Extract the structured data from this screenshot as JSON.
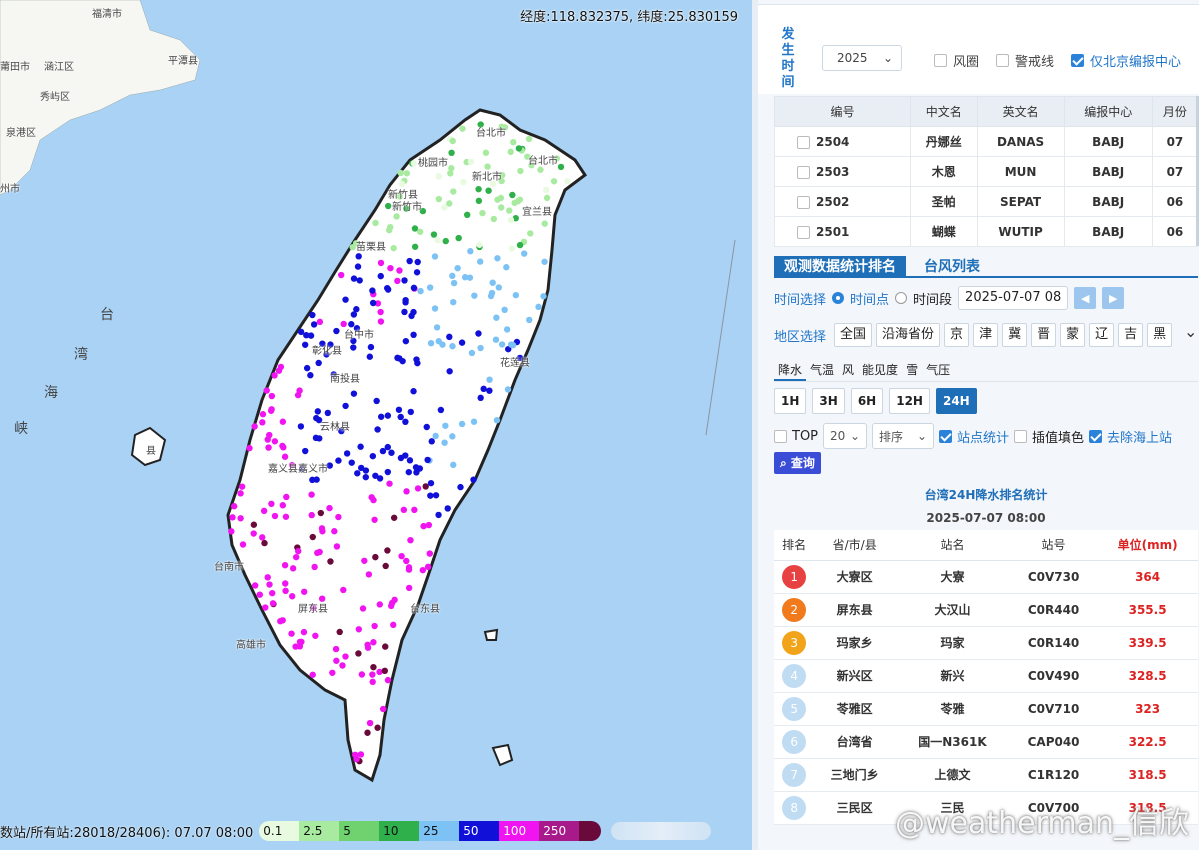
{
  "map": {
    "coord": "经度:118.832375, 纬度:25.830159",
    "labels": [
      "福清市",
      "平潭县",
      "莆田市",
      "涵江区",
      "秀屿区",
      "泉港区",
      "州市",
      "台北市",
      "桃园市",
      "新北市",
      "台北市",
      "新竹县",
      "新竹市",
      "宜兰县",
      "苗栗县",
      "台中市",
      "彰化县",
      "南投县",
      "花莲县",
      "云林县",
      "嘉义县",
      "嘉义市",
      "台南市",
      "屏东县",
      "台东县",
      "高雄市",
      "县"
    ],
    "strait": [
      "台",
      "湾",
      "海",
      "峡"
    ],
    "legend_title": "数站/所有站:28018/28406): 07.07 08:00",
    "legend": [
      {
        "label": "0.1",
        "color": "#e8fae0"
      },
      {
        "label": "2.5",
        "color": "#a8eba0"
      },
      {
        "label": "5",
        "color": "#6fd26f"
      },
      {
        "label": "10",
        "color": "#2fb04a"
      },
      {
        "label": "25",
        "color": "#7cc2f4"
      },
      {
        "label": "50",
        "color": "#1010d8"
      },
      {
        "label": "100",
        "color": "#f014f0"
      },
      {
        "label": "250",
        "color": "#a81a8c"
      },
      {
        "label": "",
        "color": "#6a0a3a"
      }
    ]
  },
  "panel": {
    "header": {
      "faction": "发生时间",
      "year": "2025",
      "opt1": "风圈",
      "opt2": "警戒线",
      "opt3": "仅北京编报中心"
    },
    "typhoon_table": {
      "headers": [
        "编号",
        "中文名",
        "英文名",
        "编报中心",
        "月份"
      ],
      "rows": [
        [
          "2504",
          "丹娜丝",
          "DANAS",
          "BABJ",
          "07"
        ],
        [
          "2503",
          "木恩",
          "MUN",
          "BABJ",
          "07"
        ],
        [
          "2502",
          "圣帕",
          "SEPAT",
          "BABJ",
          "06"
        ],
        [
          "2501",
          "蝴蝶",
          "WUTIP",
          "BABJ",
          "06"
        ]
      ]
    },
    "tabs": {
      "active": "观测数据统计排名",
      "other": "台风列表"
    },
    "time": {
      "label": "时间选择",
      "point": "时间点",
      "span": "时间段",
      "value": "2025-07-07 08"
    },
    "region": {
      "label": "地区选择",
      "items": [
        "全国",
        "沿海省份",
        "京",
        "津",
        "冀",
        "晋",
        "蒙",
        "辽",
        "吉",
        "黑"
      ]
    },
    "elements": [
      "降水",
      "气温",
      "风",
      "能见度",
      "雪",
      "气压"
    ],
    "hours": [
      "1H",
      "3H",
      "6H",
      "12H",
      "24H"
    ],
    "filter": {
      "top": "TOP",
      "top_n": "20",
      "sort": "排序",
      "station": "站点统计",
      "interp": "插值填色",
      "remove_sea": "去除海上站"
    },
    "query": "查询",
    "rank_title": "台湾24H降水排名统计",
    "rank_time": "2025-07-07 08:00",
    "rank_headers": [
      "排名",
      "省/市/县",
      "站名",
      "站号",
      "单位(mm)"
    ],
    "rank_rows": [
      [
        "1",
        "大寮区",
        "大寮",
        "C0V730",
        "364"
      ],
      [
        "2",
        "屏东县",
        "大汉山",
        "C0R440",
        "355.5"
      ],
      [
        "3",
        "玛家乡",
        "玛家",
        "C0R140",
        "339.5"
      ],
      [
        "4",
        "新兴区",
        "新兴",
        "C0V490",
        "328.5"
      ],
      [
        "5",
        "苓雅区",
        "苓雅",
        "C0V710",
        "323"
      ],
      [
        "6",
        "台湾省",
        "国一N361K",
        "CAP040",
        "322.5"
      ],
      [
        "7",
        "三地门乡",
        "上德文",
        "C1R120",
        "318.5"
      ],
      [
        "8",
        "三民区",
        "三民",
        "C0V700",
        "318.5"
      ]
    ],
    "watermark": "@weatherman_信欣"
  }
}
